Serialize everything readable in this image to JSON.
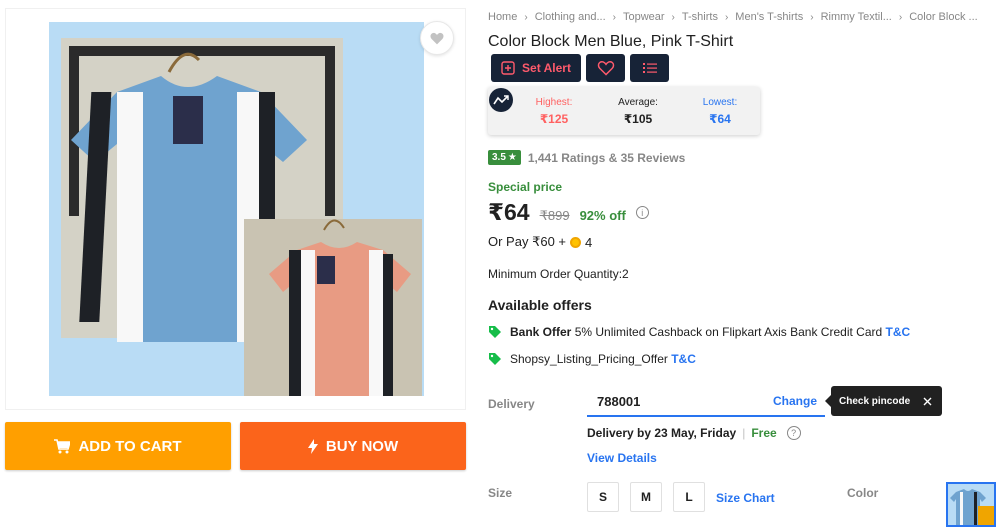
{
  "breadcrumb": [
    "Home",
    "Clothing and...",
    "Topwear",
    "T-shirts",
    "Men's T-shirts",
    "Rimmy Textil...",
    "Color Block ..."
  ],
  "product": {
    "title": "Color Block Men Blue, Pink T-Shirt"
  },
  "actions": {
    "cart": "ADD TO CART",
    "buy": "BUY NOW",
    "set_alert": "Set Alert"
  },
  "price_history": {
    "highest_label": "Highest:",
    "highest": "₹125",
    "average_label": "Average:",
    "average": "₹105",
    "lowest_label": "Lowest:",
    "lowest": "₹64"
  },
  "rating": {
    "score": "3.5",
    "summary": "1,441 Ratings & 35 Reviews"
  },
  "pricing": {
    "special_label": "Special price",
    "current": "₹64",
    "mrp": "₹899",
    "discount": "92% off",
    "or_pay": "Or Pay ₹60 +",
    "coins": "4"
  },
  "min_order": "Minimum Order Quantity:2",
  "offers": {
    "heading": "Available offers",
    "items": [
      {
        "bold": "Bank Offer",
        "text": "5% Unlimited Cashback on Flipkart Axis Bank Credit Card",
        "tc": "T&C"
      },
      {
        "text": "Shopsy_Listing_Pricing_Offer",
        "tc": "T&C"
      }
    ]
  },
  "delivery": {
    "label": "Delivery",
    "pincode": "788001",
    "change": "Change",
    "tooltip": "Check pincode",
    "date": "Delivery by 23 May, Friday",
    "free": "Free",
    "help": "?",
    "view_details": "View Details"
  },
  "size": {
    "label": "Size",
    "options": [
      "S",
      "M",
      "L"
    ],
    "chart": "Size Chart"
  },
  "color": {
    "label": "Color"
  },
  "colors": {
    "cart": "#ff9f00",
    "buy": "#fb641b",
    "link": "#2874f0",
    "green": "#388e3c",
    "navy": "#172337"
  }
}
